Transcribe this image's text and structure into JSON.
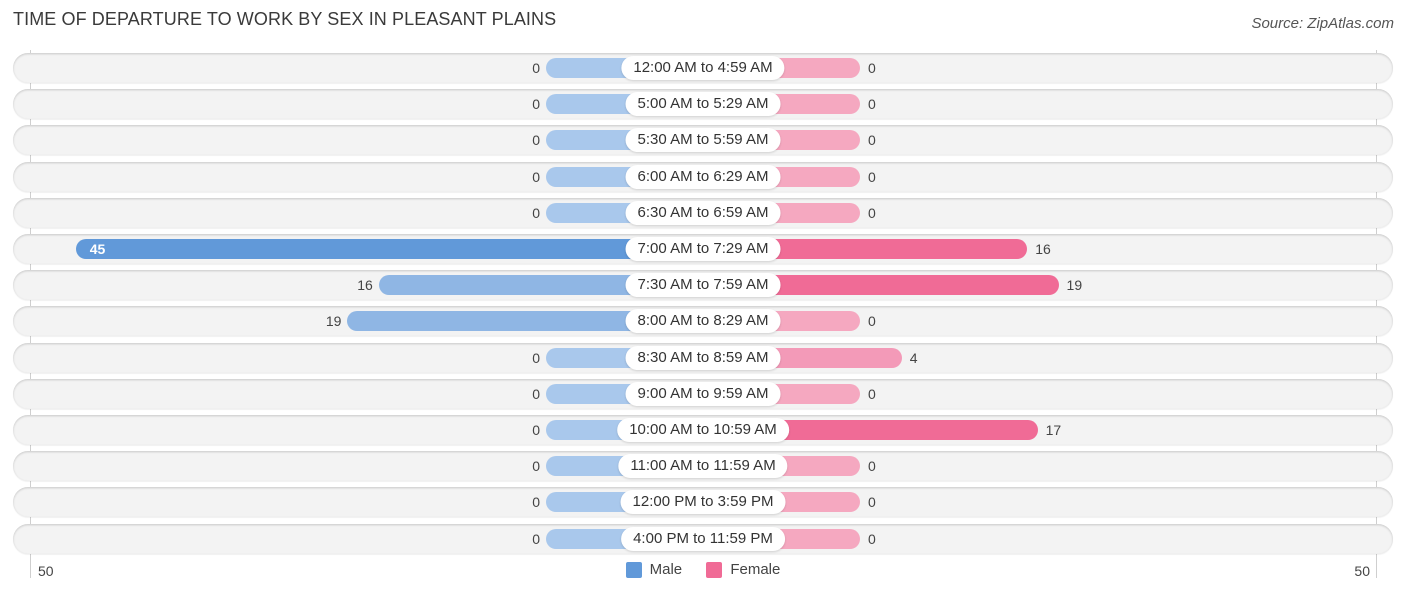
{
  "chart_data": {
    "type": "bar",
    "orientation": "horizontal-diverging",
    "title": "TIME OF DEPARTURE TO WORK BY SEX IN PLEASANT PLAINS",
    "source": "Source: ZipAtlas.com",
    "categories": [
      "12:00 AM to 4:59 AM",
      "5:00 AM to 5:29 AM",
      "5:30 AM to 5:59 AM",
      "6:00 AM to 6:29 AM",
      "6:30 AM to 6:59 AM",
      "7:00 AM to 7:29 AM",
      "7:30 AM to 7:59 AM",
      "8:00 AM to 8:29 AM",
      "8:30 AM to 8:59 AM",
      "9:00 AM to 9:59 AM",
      "10:00 AM to 10:59 AM",
      "11:00 AM to 11:59 AM",
      "12:00 PM to 3:59 PM",
      "4:00 PM to 11:59 PM"
    ],
    "series": [
      {
        "name": "Male",
        "values": [
          0,
          0,
          0,
          0,
          0,
          45,
          16,
          19,
          0,
          0,
          0,
          0,
          0,
          0
        ],
        "color": "#6199d9",
        "light_color": "#a9c8ec"
      },
      {
        "name": "Female",
        "values": [
          0,
          0,
          0,
          0,
          0,
          16,
          19,
          0,
          4,
          0,
          17,
          0,
          0,
          0
        ],
        "color": "#f06b96",
        "light_color": "#f5a8c0"
      }
    ],
    "axis": {
      "left_label": "50",
      "right_label": "50",
      "range": [
        -50,
        50
      ]
    },
    "legend": {
      "position": "bottom-center",
      "entries": [
        "Male",
        "Female"
      ]
    },
    "grid": false
  }
}
